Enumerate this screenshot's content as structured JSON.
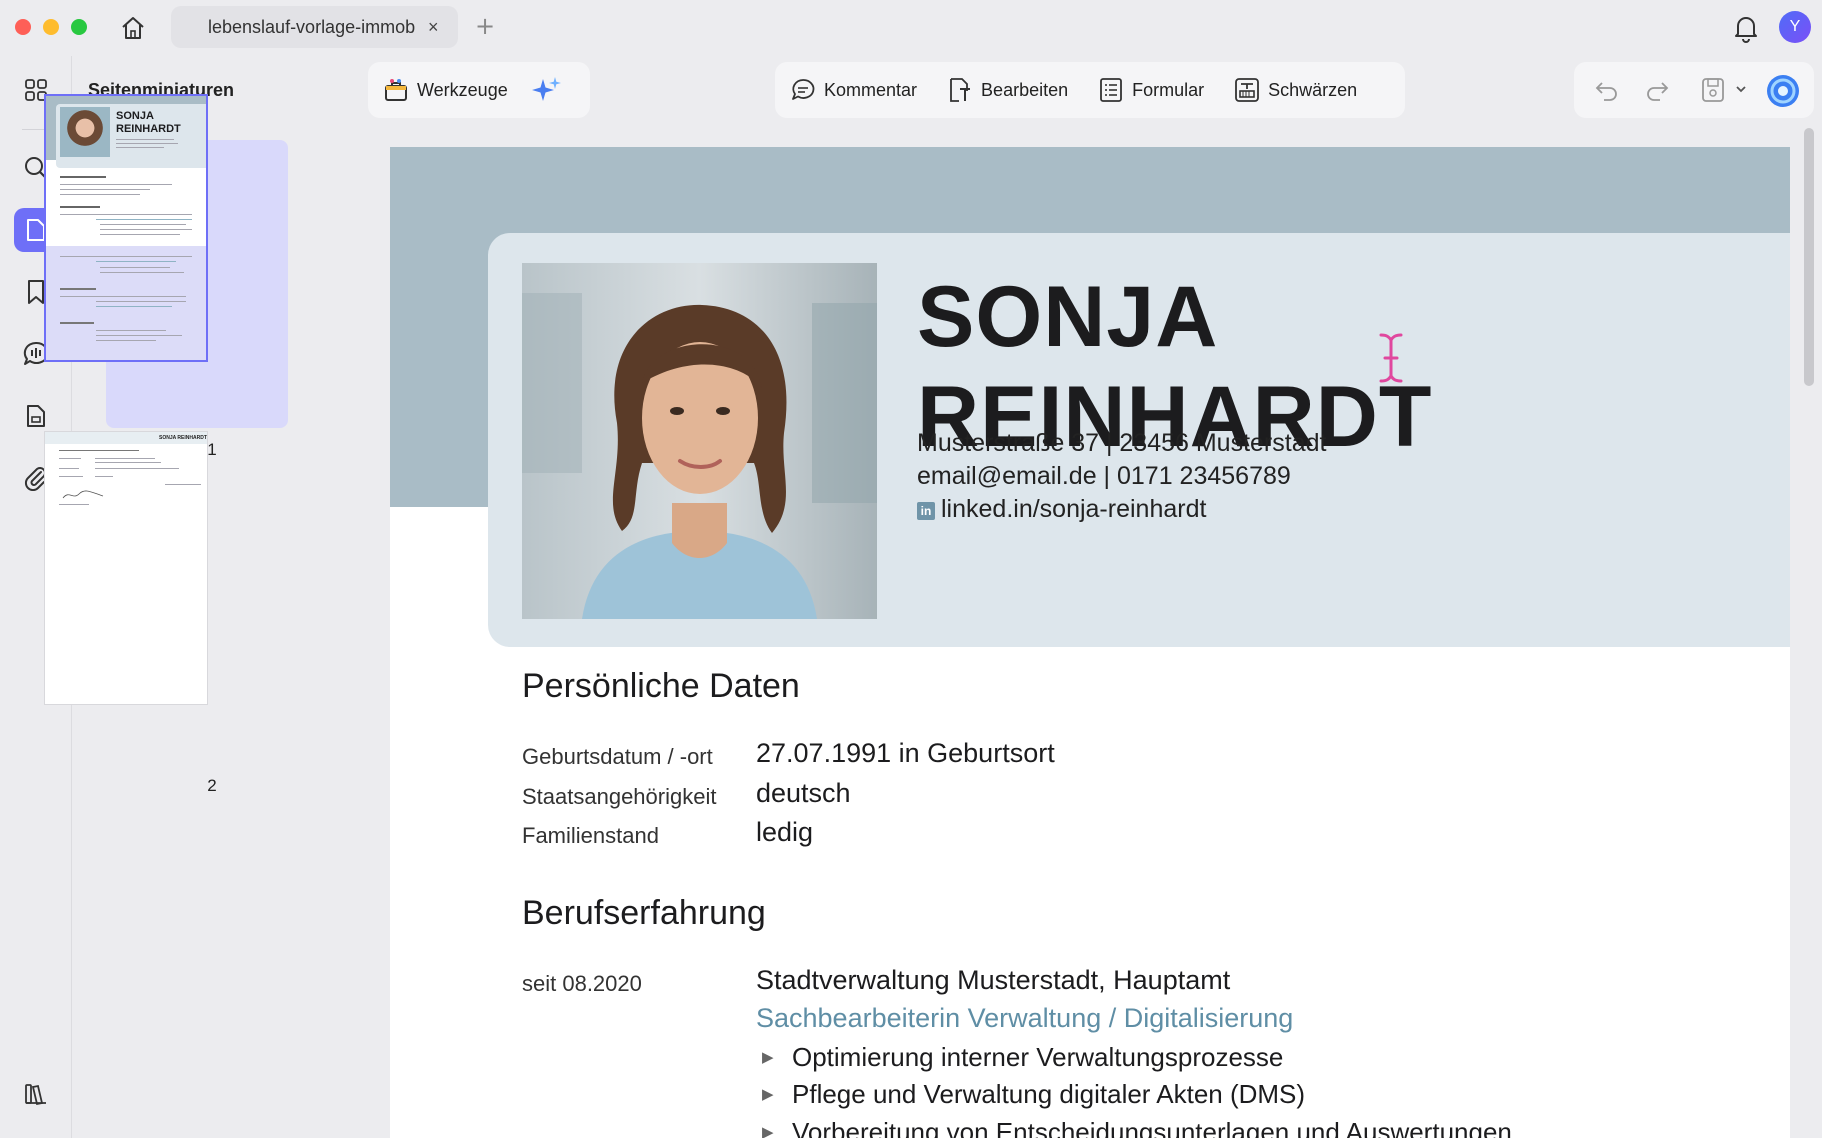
{
  "tab": {
    "title": "lebenslauf-vorlage-immob",
    "close": "×",
    "add": "+"
  },
  "user": {
    "initial": "Y"
  },
  "sidebar": {
    "title": "Seitenminiaturen",
    "pages": [
      "1",
      "2"
    ]
  },
  "thumb1": {
    "name1": "SONJA",
    "name2": "REINHARDT"
  },
  "thumb2": {
    "header": "SONJA REINHARDT"
  },
  "toolbar": {
    "tools_label": "Werkzeuge",
    "comment_label": "Kommentar",
    "edit_label": "Bearbeiten",
    "form_label": "Formular",
    "redact_label": "Schwärzen"
  },
  "resume": {
    "first_name": "SONJA",
    "last_name": "REINHARDT",
    "address": "Musterstraße 37 | 23456 Musterstadt",
    "contact": "email@email.de | 0171 23456789",
    "linkedin_badge": "in",
    "linkedin": "linked.in/sonja-reinhardt",
    "personal": {
      "heading": "Persönliche Daten",
      "rows": [
        {
          "label": "Geburtsdatum / -ort",
          "value": "27.07.1991 in Geburtsort"
        },
        {
          "label": "Staatsangehörigkeit",
          "value": "deutsch"
        },
        {
          "label": "Familienstand",
          "value": "ledig"
        }
      ]
    },
    "experience": {
      "heading": "Berufserfahrung",
      "jobs": [
        {
          "period": "seit 08.2020",
          "employer": "Stadtverwaltung Musterstadt, Hauptamt",
          "title": "Sachbearbeiterin Verwaltung / Digitalisierung",
          "bullets": [
            "Optimierung interner Verwaltungsprozesse",
            "Pflege und Verwaltung digitaler Akten (DMS)",
            "Vorbereitung von Entscheidungsunterlagen und Auswertungen"
          ]
        }
      ]
    }
  },
  "colors": {
    "accent": "#6e6ff7",
    "band": "#a9bcc6",
    "card": "#dde6ec",
    "jobtitle": "#5f8ea5",
    "cursor": "#e0479e"
  }
}
